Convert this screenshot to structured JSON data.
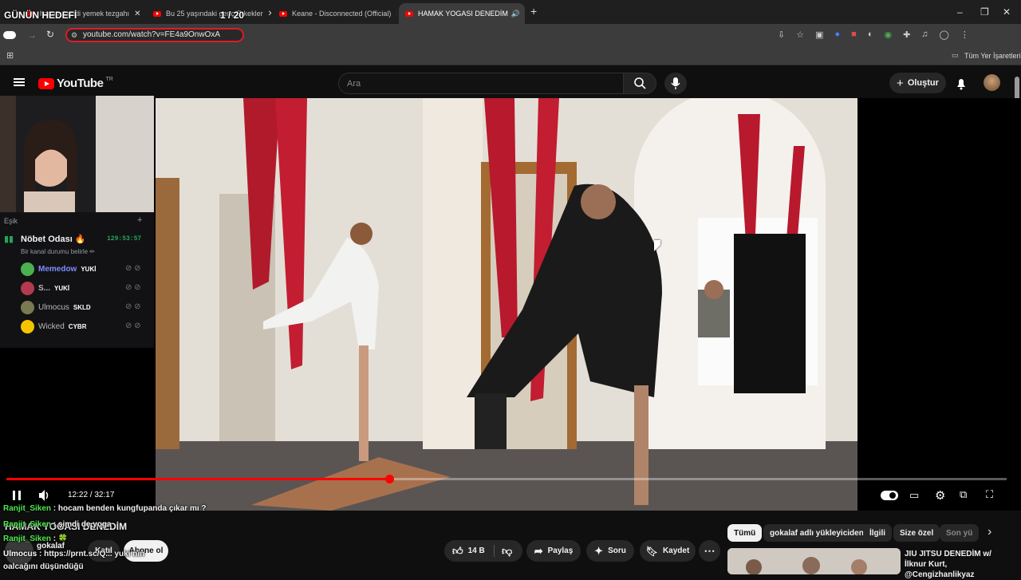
{
  "browser": {
    "tabs": [
      {
        "label": "hocam kendi yemek tezgahı",
        "close": "✕"
      },
      {
        "label": "Bu 25 yaşındaki genç Erkekler",
        "close": "✕"
      },
      {
        "label": "Keane - Disconnected (Official)",
        "close": "✕"
      },
      {
        "label": "HAMAK YOGASI DENEDİM",
        "close": "✕"
      }
    ],
    "new_tab": "+",
    "url": "youtube.com/watch?v=FE4a9OnwOxA",
    "bookmarks_all": "Tüm Yer İşaretleri",
    "window_controls": [
      "–",
      "❐",
      "✕"
    ]
  },
  "youtube": {
    "logo_text": "YouTube",
    "region": "TR",
    "search_placeholder": "Ara",
    "create_label": "Oluştur"
  },
  "stream_overlay": {
    "goal_label": "GÜNÜN HEDEFİ",
    "goal_count": "1 / 20",
    "threshold_label": "Eşik",
    "channel_name": "Nöbet Odası 🔥",
    "channel_timer": "129:53:57",
    "channel_status": "Bir kanal durumu belirle ✏",
    "members": [
      {
        "name": "Memedow",
        "badge": "YUKİ",
        "color": "#7f8cff"
      },
      {
        "name": "S...",
        "badge": "YUKİ",
        "color": "#b9b9b9"
      },
      {
        "name": "Ulmocus",
        "badge": "SKLD",
        "color": "#b9b9b9"
      },
      {
        "name": "Wicked",
        "badge": "CYBR",
        "color": "#b9b9b9"
      }
    ],
    "chat": [
      {
        "user": "Ranjit_Siken",
        "text": " : hocam benden kungfupanda çıkar mı ?"
      },
      {
        "user": "Ranjit_Siken",
        "text": " : şimdi de yoga"
      },
      {
        "user": "Ranjit_Siken",
        "text": " : 🍀"
      },
      {
        "user": "Ulmocus",
        "text": " : https://prnt.sc/Q... yuki nin"
      },
      {
        "user": "",
        "text": "oalcağını düşündüğü"
      }
    ]
  },
  "player": {
    "time_current": "12:22",
    "time_total": "32:17",
    "time_display": "12:22 / 32:17",
    "progress": 0.383
  },
  "video_info": {
    "title": "HAMAK YOGASI DENEDİM",
    "channel": "gokalaf",
    "join_label": "Katıl",
    "subscribe_label": "Abone ol",
    "likes": "14 B",
    "share_label": "Paylaş",
    "ask_label": "Soru",
    "save_label": "Kaydet",
    "more": "⋯"
  },
  "related": {
    "chips": [
      "Tümü",
      "gokalaf adlı yükleyiciden",
      "İlgili",
      "Size özel",
      "Son yü"
    ],
    "first_title": "JIU JITSU DENEDİM w/ İlknur Kurt, @Cengizhanlikyaz"
  },
  "colors": {
    "accent": "#ff0000",
    "bg": "#0f0f0f",
    "chat_user": "#4fe84f"
  }
}
